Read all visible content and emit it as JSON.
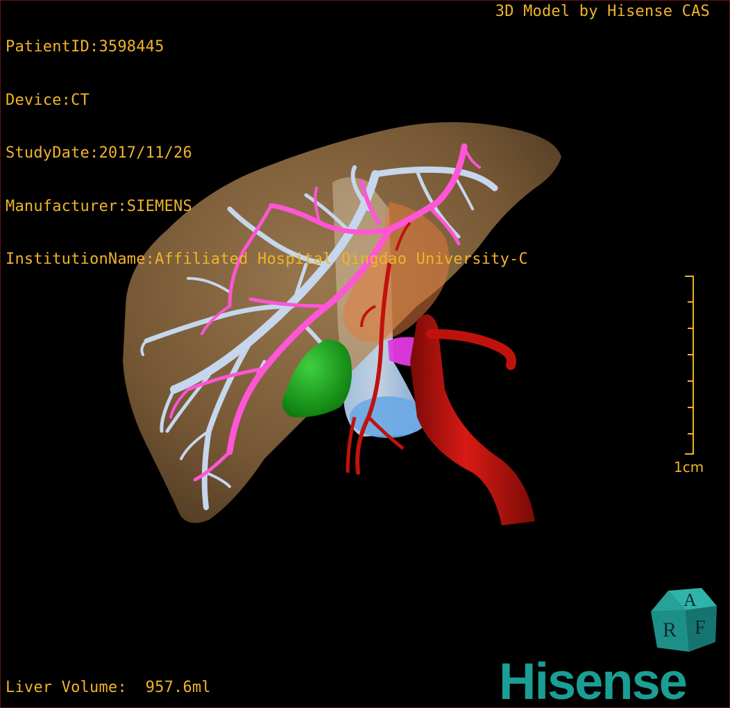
{
  "meta": {
    "patient_id": "PatientID:3598445",
    "device": "Device:CT",
    "study_date": "StudyDate:2017/11/26",
    "manufacturer": "Manufacturer:SIEMENS",
    "institution": "InstitutionName:Affiliated Hospital Qingdao University-C"
  },
  "brand_top": "3D Model by Hisense CAS",
  "volume": {
    "text": "Liver Volume:  957.6ml"
  },
  "scale": {
    "label": "1cm"
  },
  "logo": {
    "text": "Hisense",
    "color": "#1a9e95"
  },
  "cube": {
    "letters": [
      "R",
      "A",
      "F"
    ],
    "color": "#1e8f88"
  },
  "colors": {
    "overlay_text": "#f0b429",
    "liver": "#b58a55",
    "hepatic_vein": "#c6d6ec",
    "portal_vein": "#ff55d6",
    "artery": "#c0120d",
    "gallbladder": "#17a317",
    "ivc": "#7fb6ee"
  }
}
